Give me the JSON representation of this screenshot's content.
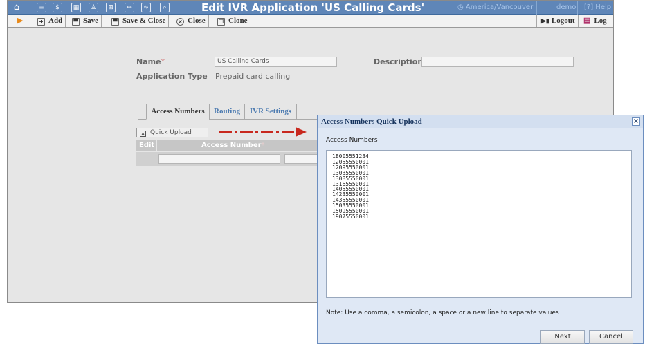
{
  "header": {
    "title": "Edit IVR Application 'US Calling Cards'",
    "timezone": "America/Vancouver",
    "user": "demo",
    "help": "Help",
    "icons": [
      "home-icon",
      "list-icon",
      "dollar-icon",
      "grid-icon",
      "person-icon",
      "network-icon",
      "arrow-box-icon",
      "chart-icon",
      "search-icon"
    ]
  },
  "toolbar": {
    "add": "Add",
    "save": "Save",
    "save_close": "Save & Close",
    "close": "Close",
    "clone": "Clone",
    "logout": "Logout",
    "log": "Log"
  },
  "form": {
    "name_label": "Name",
    "required_mark": "*",
    "name_value": "US Calling Cards",
    "description_label": "Description",
    "description_value": "",
    "app_type_label": "Application Type",
    "app_type_value": "Prepaid card calling"
  },
  "tabs": [
    "Access Numbers",
    "Routing",
    "IVR Settings"
  ],
  "grid": {
    "quick_upload": "Quick Upload",
    "columns": [
      "Edit",
      "Access Number"
    ]
  },
  "dialog": {
    "title": "Access Numbers Quick Upload",
    "label": "Access Numbers",
    "numbers": [
      "18005551234",
      "12055550001",
      "12095550001",
      "13035550001",
      "13085550001",
      "13165550001",
      "14055550001",
      "14235550001",
      "14355550001",
      "15035550001",
      "15095550001",
      "19075550001"
    ],
    "note": "Note: Use a comma, a semicolon, a space or a new line to separate values",
    "next": "Next",
    "cancel": "Cancel"
  },
  "colors": {
    "header_bg": "#5f86b8",
    "accent_link": "#4b7ab0",
    "arrow": "#c8281e"
  }
}
